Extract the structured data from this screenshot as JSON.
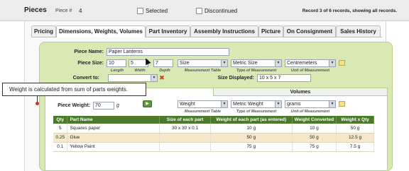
{
  "header": {
    "title": "Pieces",
    "piece_no_label": "Piece #",
    "piece_no_value": "4",
    "selected_label": "Selected",
    "discontinued_label": "Discontinued",
    "record_info": "Record 3 of 6 records, showing all records."
  },
  "tabs": [
    {
      "label": "Pricing",
      "active": false
    },
    {
      "label": "Dimensions, Weights, Volumes",
      "active": true
    },
    {
      "label": "Part Inventory",
      "active": false
    },
    {
      "label": "Assembly Instructions",
      "active": false
    },
    {
      "label": "Picture",
      "active": false
    },
    {
      "label": "On Consignment",
      "active": false
    },
    {
      "label": "Sales History",
      "active": false
    }
  ],
  "form": {
    "piece_name_label": "Piece Name:",
    "piece_name_value": "Paper Lanterns",
    "piece_size_label": "Piece Size:",
    "length_value": "10",
    "width_value": "5",
    "depth_value": "7",
    "length_label": "Length",
    "width_label": "Width",
    "depth_label": "Depth",
    "measurement_table_value": "Size",
    "measurement_table_label": "Measurement Table",
    "type_of_measurement_value": "Metric Size",
    "type_of_measurement_label": "Type of Measurement",
    "unit_value": "Centremeters",
    "unit_label": "Unit of Measurement",
    "convert_to_label": "Convert to:",
    "convert_to_value": "",
    "size_displayed_label": "Size Displayed:",
    "size_displayed_value": "10 x 5 x 7",
    "volumes_label": "Volumes",
    "piece_weight_label": "Piece Weight:",
    "piece_weight_value": "70",
    "piece_weight_unit": "g",
    "weight_table_value": "Weight",
    "weight_table_label": "Measurement Table",
    "weight_type_value": "Metric Weight",
    "weight_type_label": "Type of Measurement",
    "weight_unit_value": "grams",
    "weight_unit_label": "Unit of Measurement"
  },
  "callout": {
    "text": "Weight is calculated from sum of parts weights."
  },
  "parts_table": {
    "columns": [
      "Qty",
      "Part Name",
      "Size of each part",
      "Weight of each part (as entered)",
      "Weight Converted",
      "Weight x Qty"
    ],
    "rows": [
      [
        "5",
        "Squares paper",
        "30 x 30 x 0.1",
        "10 g",
        "10 g",
        "50 g"
      ],
      [
        "0.25",
        "Glue",
        "",
        "50 g",
        "50 g",
        "12.5 g"
      ],
      [
        "0.1",
        "Yellow Paint",
        "",
        "75 g",
        "75 g",
        "7.5 g"
      ]
    ]
  }
}
